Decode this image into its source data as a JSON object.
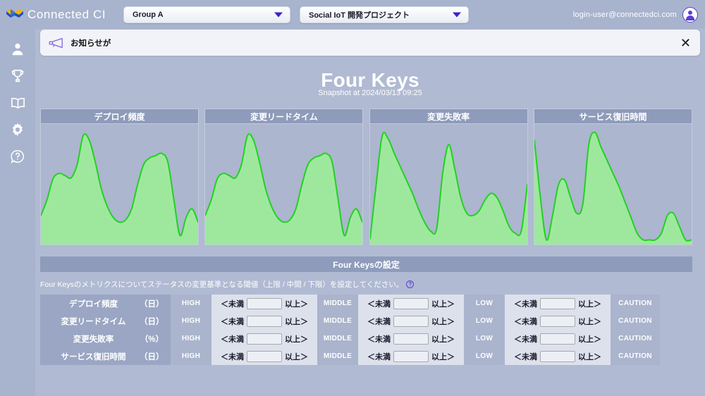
{
  "brand": {
    "name": "Connected CI",
    "logo_icon": "butterfly-logo-icon"
  },
  "header": {
    "group_select": {
      "value": "Group A",
      "icon": "chevron-down-icon"
    },
    "project_select": {
      "value": "Social IoT 開発プロジェクト",
      "icon": "chevron-down-icon"
    },
    "account_email": "login-user@connectedci.com",
    "avatar_icon": "user-avatar-icon"
  },
  "sidebar": {
    "items": [
      {
        "icon": "person-icon",
        "name": "sidebar-item-profile"
      },
      {
        "icon": "trophy-icon",
        "name": "sidebar-item-awards"
      },
      {
        "icon": "book-icon",
        "name": "sidebar-item-docs"
      },
      {
        "icon": "gear-icon",
        "name": "sidebar-item-settings"
      },
      {
        "icon": "help-circle-icon",
        "name": "sidebar-item-help"
      }
    ]
  },
  "notification": {
    "icon": "megaphone-icon",
    "text": "お知らせが",
    "close_label": "✕"
  },
  "page": {
    "title": "Four Keys",
    "subtitle": "Snapshot at 2024/03/13 09:25"
  },
  "chart_data": [
    {
      "type": "area",
      "title": "デプロイ頻度",
      "line_color": "#22d122",
      "fill_color": "#9ee89e",
      "x": [
        0,
        4,
        8,
        12,
        16,
        20,
        24,
        28,
        32,
        36,
        40,
        44,
        48,
        52,
        56,
        60,
        64,
        68,
        72,
        76,
        80,
        84,
        88,
        92,
        96,
        100
      ],
      "values": [
        24,
        38,
        57,
        62,
        60,
        58,
        70,
        96,
        92,
        72,
        48,
        32,
        22,
        18,
        20,
        30,
        52,
        70,
        76,
        78,
        80,
        72,
        38,
        6,
        22,
        30,
        18
      ],
      "ylim": [
        0,
        100
      ]
    },
    {
      "type": "area",
      "title": "変更リードタイム",
      "line_color": "#22d122",
      "fill_color": "#9ee89e",
      "x": [
        0,
        4,
        8,
        12,
        16,
        20,
        24,
        28,
        32,
        36,
        40,
        44,
        48,
        52,
        56,
        60,
        64,
        68,
        72,
        76,
        80,
        84,
        88,
        92,
        96,
        100
      ],
      "values": [
        24,
        38,
        57,
        62,
        60,
        58,
        70,
        96,
        92,
        72,
        48,
        32,
        22,
        18,
        20,
        30,
        52,
        70,
        76,
        78,
        80,
        72,
        38,
        6,
        22,
        30,
        18
      ],
      "ylim": [
        0,
        100
      ]
    },
    {
      "type": "area",
      "title": "変更失敗率",
      "line_color": "#22d122",
      "fill_color": "#9ee89e",
      "x": [
        0,
        4,
        8,
        12,
        16,
        20,
        24,
        28,
        32,
        36,
        40,
        44,
        48,
        52,
        56,
        60,
        64,
        68,
        72,
        76,
        80,
        84,
        88,
        92,
        96,
        100
      ],
      "values": [
        3,
        52,
        96,
        93,
        80,
        68,
        56,
        44,
        30,
        18,
        10,
        12,
        62,
        88,
        66,
        40,
        26,
        24,
        28,
        38,
        44,
        40,
        28,
        14,
        8,
        10,
        52
      ],
      "ylim": [
        0,
        100
      ]
    },
    {
      "type": "area",
      "title": "サービス復旧時間",
      "line_color": "#22d122",
      "fill_color": "#9ee89e",
      "x": [
        0,
        4,
        8,
        12,
        16,
        20,
        24,
        28,
        32,
        36,
        40,
        44,
        48,
        52,
        56,
        60,
        64,
        68,
        72,
        76,
        80,
        84,
        88,
        92,
        96,
        100
      ],
      "values": [
        92,
        40,
        2,
        24,
        52,
        56,
        40,
        26,
        34,
        88,
        99,
        86,
        74,
        62,
        50,
        36,
        22,
        8,
        2,
        2,
        2,
        8,
        24,
        26,
        14,
        2,
        2
      ],
      "ylim": [
        0,
        100
      ]
    }
  ],
  "settings": {
    "section_title": "Four Keysの設定",
    "description": "Four Keysのメトリクスについてステータスの変更基準となる閾値（上限 / 中間 / 下限）を設定してください。",
    "help_icon": "question-mark-icon",
    "metrics": [
      {
        "name": "デプロイ頻度",
        "unit": "（日）"
      },
      {
        "name": "変更リードタイム",
        "unit": "（日）"
      },
      {
        "name": "変更失敗率",
        "unit": "（%）"
      },
      {
        "name": "サービス復旧時間",
        "unit": "（日）"
      }
    ],
    "levels": [
      "HIGH",
      "MIDDLE",
      "LOW",
      "CAUTION"
    ],
    "operator_lt": "＜未満",
    "operator_gt": "以上＞",
    "input_placeholder": "",
    "input_values": [
      "",
      "",
      "",
      "",
      "",
      "",
      "",
      "",
      "",
      "",
      "",
      ""
    ]
  },
  "colors": {
    "background": "#b0bad2",
    "chrome": "#a8b3cd",
    "header_bar": "#8e9bbb",
    "accent_purple": "#5b3fd6",
    "chart_line": "#22d122",
    "chart_fill": "#9ee89e"
  }
}
